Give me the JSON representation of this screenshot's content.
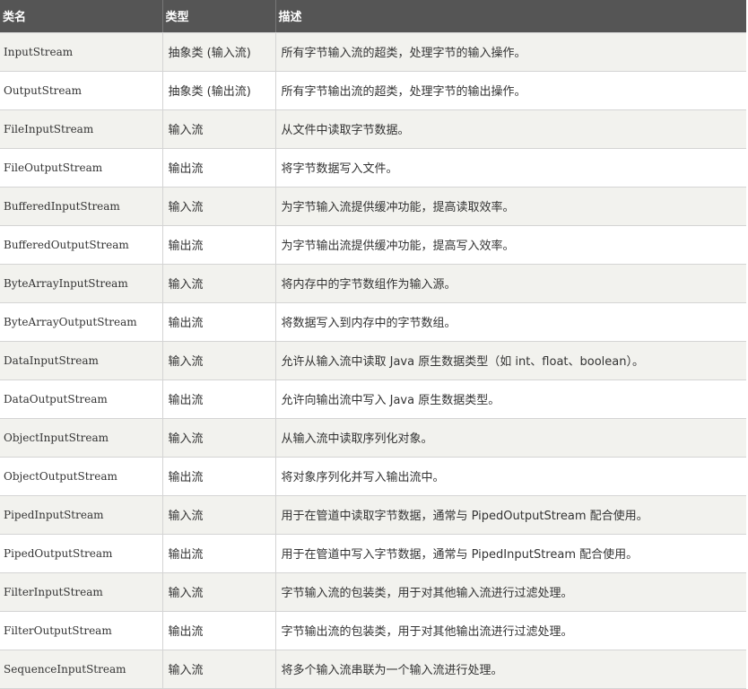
{
  "table": {
    "headers": [
      "类名",
      "类型",
      "描述"
    ],
    "rows": [
      [
        "InputStream",
        "抽象类 (输入流)",
        "所有字节输入流的超类，处理字节的输入操作。"
      ],
      [
        "OutputStream",
        "抽象类 (输出流)",
        "所有字节输出流的超类，处理字节的输出操作。"
      ],
      [
        "FileInputStream",
        "输入流",
        "从文件中读取字节数据。"
      ],
      [
        "FileOutputStream",
        "输出流",
        "将字节数据写入文件。"
      ],
      [
        "BufferedInputStream",
        "输入流",
        "为字节输入流提供缓冲功能，提高读取效率。"
      ],
      [
        "BufferedOutputStream",
        "输出流",
        "为字节输出流提供缓冲功能，提高写入效率。"
      ],
      [
        "ByteArrayInputStream",
        "输入流",
        "将内存中的字节数组作为输入源。"
      ],
      [
        "ByteArrayOutputStream",
        "输出流",
        "将数据写入到内存中的字节数组。"
      ],
      [
        "DataInputStream",
        "输入流",
        "允许从输入流中读取 Java 原生数据类型（如 int、float、boolean）。"
      ],
      [
        "DataOutputStream",
        "输出流",
        "允许向输出流中写入 Java 原生数据类型。"
      ],
      [
        "ObjectInputStream",
        "输入流",
        "从输入流中读取序列化对象。"
      ],
      [
        "ObjectOutputStream",
        "输出流",
        "将对象序列化并写入输出流中。"
      ],
      [
        "PipedInputStream",
        "输入流",
        "用于在管道中读取字节数据，通常与 PipedOutputStream 配合使用。"
      ],
      [
        "PipedOutputStream",
        "输出流",
        "用于在管道中写入字节数据，通常与 PipedInputStream 配合使用。"
      ],
      [
        "FilterInputStream",
        "输入流",
        "字节输入流的包装类，用于对其他输入流进行过滤处理。"
      ],
      [
        "FilterOutputStream",
        "输出流",
        "字节输出流的包装类，用于对其他输出流进行过滤处理。"
      ],
      [
        "SequenceInputStream",
        "输入流",
        "将多个输入流串联为一个输入流进行处理。"
      ]
    ]
  }
}
